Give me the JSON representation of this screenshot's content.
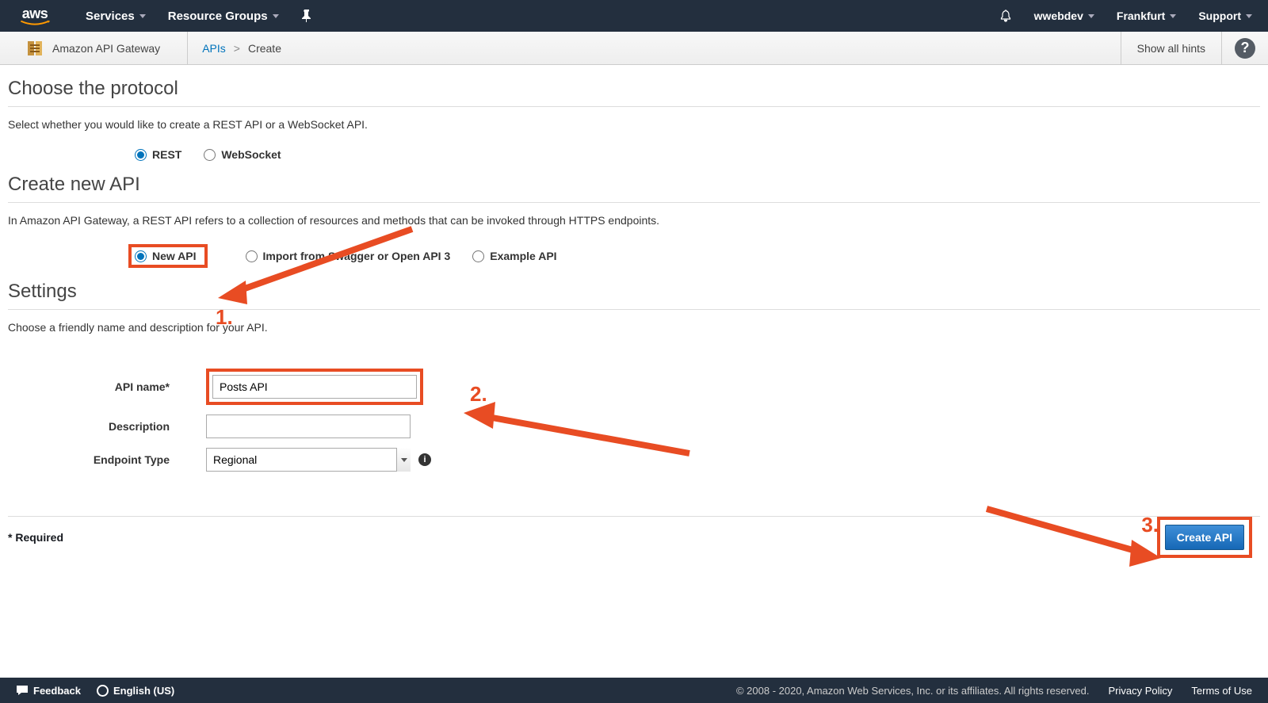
{
  "nav": {
    "services": "Services",
    "resource_groups": "Resource Groups",
    "user": "wwebdev",
    "region": "Frankfurt",
    "support": "Support"
  },
  "crumb": {
    "service": "Amazon API Gateway",
    "link_apis": "APIs",
    "current": "Create",
    "show_hints": "Show all hints"
  },
  "section_protocol": {
    "title": "Choose the protocol",
    "desc": "Select whether you would like to create a REST API or a WebSocket API.",
    "rest": "REST",
    "websocket": "WebSocket"
  },
  "section_create": {
    "title": "Create new API",
    "desc": "In Amazon API Gateway, a REST API refers to a collection of resources and methods that can be invoked through HTTPS endpoints.",
    "new_api": "New API",
    "import": "Import from Swagger or Open API 3",
    "example": "Example API"
  },
  "section_settings": {
    "title": "Settings",
    "desc": "Choose a friendly name and description for your API.",
    "api_name_label": "API name*",
    "api_name_value": "Posts API",
    "description_label": "Description",
    "description_value": "",
    "endpoint_label": "Endpoint Type",
    "endpoint_value": "Regional"
  },
  "footer": {
    "required": "* Required",
    "create_btn": "Create API"
  },
  "global_footer": {
    "feedback": "Feedback",
    "language": "English (US)",
    "copy": "© 2008 - 2020, Amazon Web Services, Inc. or its affiliates. All rights reserved.",
    "privacy": "Privacy Policy",
    "terms": "Terms of Use"
  },
  "annotations": {
    "one": "1.",
    "two": "2.",
    "three": "3."
  }
}
